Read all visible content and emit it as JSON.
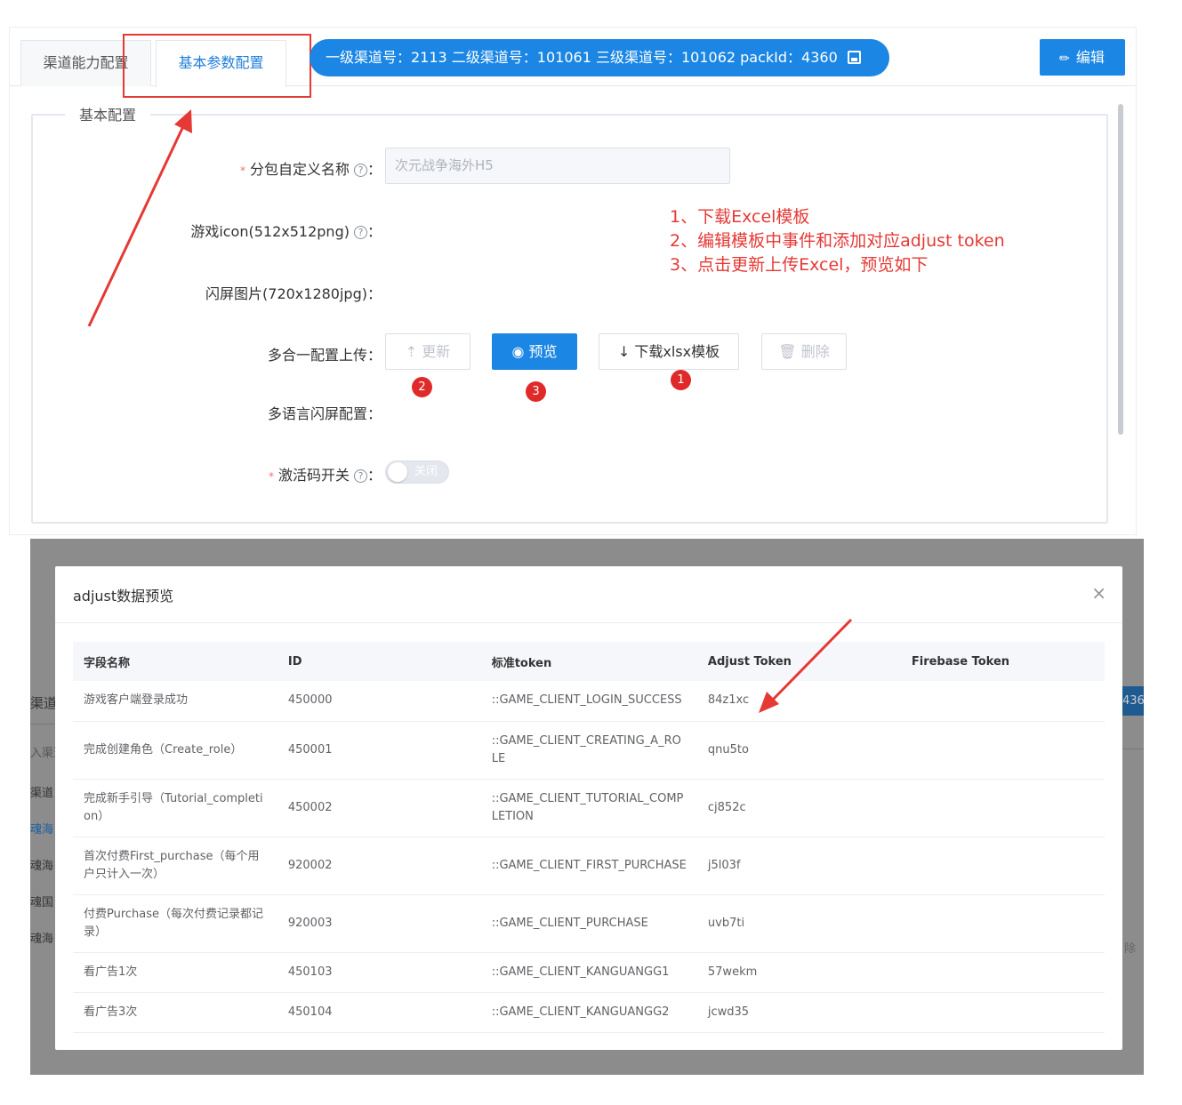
{
  "tabs": {
    "tab1": "渠道能力配置",
    "tab2": "基本参数配置"
  },
  "channel_pill": "一级渠道号：2113  二级渠道号：101061   三级渠道号：101062  packId：4360",
  "edit_button": "编辑",
  "section_title": "基本配置",
  "form": {
    "subpackage_label": "分包自定义名称",
    "subpackage_value": "次元战争海外H5",
    "icon_label": "游戏icon(512x512png)",
    "splash_label": "闪屏图片(720x1280jpg)：",
    "upload_label": "多合一配置上传：",
    "multilang_label": "多语言闪屏配置：",
    "activation_label": "激活码开关",
    "switch_text": "关闭",
    "colon": "："
  },
  "buttons": {
    "update": "更新",
    "preview": "预览",
    "download": "下载xlsx模板",
    "delete": "删除"
  },
  "markers": {
    "m1": "1",
    "m2": "2",
    "m3": "3"
  },
  "annotation": {
    "line1": "1、下载Excel模板",
    "line2": "2、编辑模板中事件和添加对应adjust token",
    "line3": "3、点击更新上传Excel，预览如下"
  },
  "background": {
    "t1": "渠道",
    "t2": "入渠道",
    "t3": "渠道",
    "t4": "魂海",
    "t5": "魂海",
    "t6": "魂国",
    "t7": "魂海",
    "t8": "436",
    "t9": "除"
  },
  "modal": {
    "title": "adjust数据预览",
    "close": "×",
    "headers": [
      "字段名称",
      "ID",
      "标准token",
      "Adjust Token",
      "Firebase Token"
    ],
    "rows": [
      {
        "name": "游戏客户端登录成功",
        "id": "450000",
        "token": "::GAME_CLIENT_LOGIN_SUCCESS",
        "adjust": "84z1xc",
        "firebase": ""
      },
      {
        "name": "完成创建角色（Create_role）",
        "id": "450001",
        "token": "::GAME_CLIENT_CREATING_A_ROLE",
        "adjust": "qnu5to",
        "firebase": ""
      },
      {
        "name": "完成新手引导（Tutorial_completion）",
        "id": "450002",
        "token": "::GAME_CLIENT_TUTORIAL_COMPLETION",
        "adjust": "cj852c",
        "firebase": ""
      },
      {
        "name": "首次付费First_purchase（每个用户只计入一次）",
        "id": "920002",
        "token": "::GAME_CLIENT_FIRST_PURCHASE",
        "adjust": "j5l03f",
        "firebase": ""
      },
      {
        "name": "付费Purchase（每次付费记录都记录）",
        "id": "920003",
        "token": "::GAME_CLIENT_PURCHASE",
        "adjust": "uvb7ti",
        "firebase": ""
      },
      {
        "name": "看广告1次",
        "id": "450103",
        "token": "::GAME_CLIENT_KANGUANGG1",
        "adjust": "57wekm",
        "firebase": ""
      },
      {
        "name": "看广告3次",
        "id": "450104",
        "token": "::GAME_CLIENT_KANGUANGG2",
        "adjust": "jcwd35",
        "firebase": ""
      }
    ]
  },
  "colors": {
    "primary": "#1b86e3",
    "annotation": "#e53935",
    "marker": "#e02a2a"
  }
}
